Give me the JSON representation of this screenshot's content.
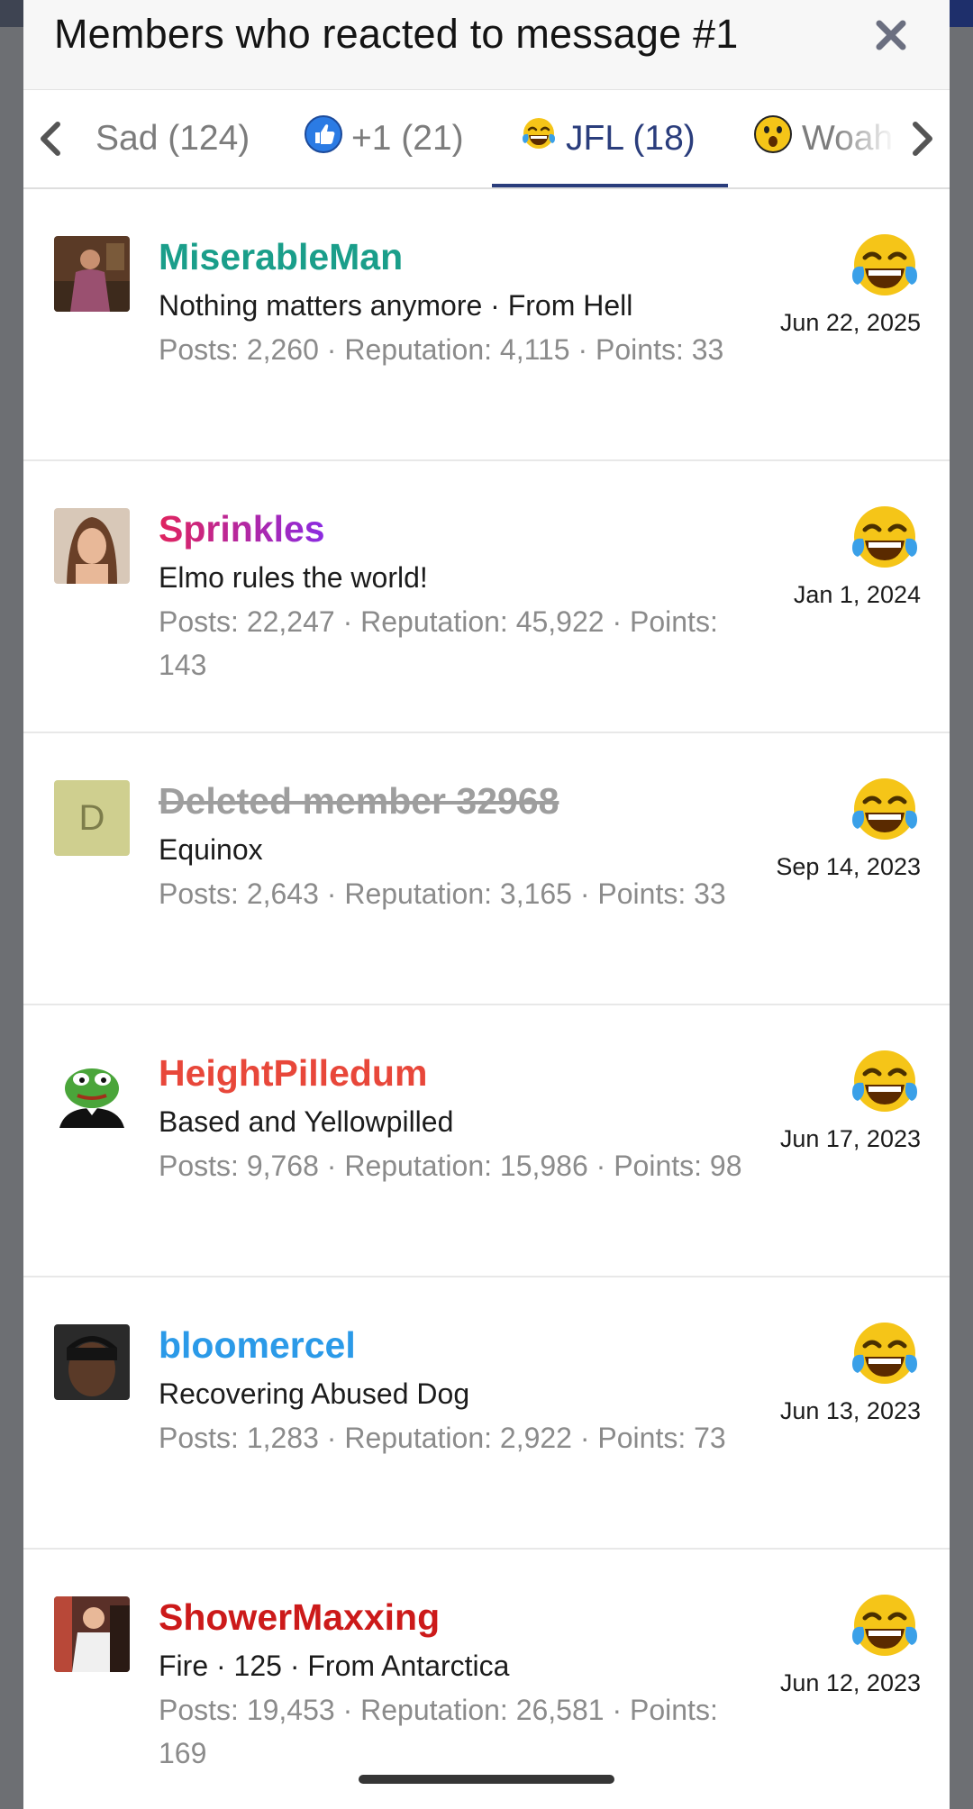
{
  "modal": {
    "title": "Members who reacted to message #1",
    "close_icon": "close-icon"
  },
  "tabs": [
    {
      "label": "Sad (124)",
      "icon": "",
      "active": false
    },
    {
      "label": "+1 (21)",
      "icon": "thumbs-up-icon",
      "active": false
    },
    {
      "label": "JFL (18)",
      "icon": "laughing-crying-emoji-icon",
      "active": true
    },
    {
      "label": "Woah",
      "icon": "shocked-emoji-icon",
      "active": false
    }
  ],
  "members": [
    {
      "username": "MiserableMan",
      "username_color": "#1a9e8a",
      "tagline": "Nothing matters anymore · From Hell",
      "stats": "Posts: 2,260 · Reputation: 4,115 · Points: 33",
      "date": "Jun 22, 2025",
      "avatar": "photo"
    },
    {
      "username": "Sprinkles",
      "username_gradient": [
        "#e0245e",
        "#8a2be2"
      ],
      "tagline": "Elmo rules the world!",
      "stats": "Posts: 22,247 · Reputation: 45,922 · Points: 143",
      "date": "Jan 1, 2024",
      "avatar": "photo"
    },
    {
      "username": "Deleted member 32968",
      "deleted": true,
      "avatar_letter": "D",
      "tagline": "Equinox",
      "stats": "Posts: 2,643 · Reputation: 3,165 · Points: 33",
      "date": "Sep 14, 2023"
    },
    {
      "username": "HeightPilledum",
      "username_color": "#e8473a",
      "tagline": "Based and Yellowpilled",
      "stats": "Posts: 9,768 · Reputation: 15,986 · Points: 98",
      "date": "Jun 17, 2023",
      "avatar": "frog"
    },
    {
      "username": "bloomercel",
      "username_color": "#2b9ae8",
      "tagline": "Recovering Abused Dog",
      "stats": "Posts: 1,283 · Reputation: 2,922 · Points: 73",
      "date": "Jun 13, 2023",
      "avatar": "photo"
    },
    {
      "username": "ShowerMaxxing",
      "username_color": "#cc1a1a",
      "tagline": "Fire · 125 · From Antarctica",
      "stats": "Posts: 19,453 · Reputation: 26,581 · Points: 169",
      "date": "Jun 12, 2023",
      "avatar": "photo"
    }
  ],
  "colors": {
    "accent": "#2a3d7c",
    "muted_text": "#8b8b8b"
  }
}
